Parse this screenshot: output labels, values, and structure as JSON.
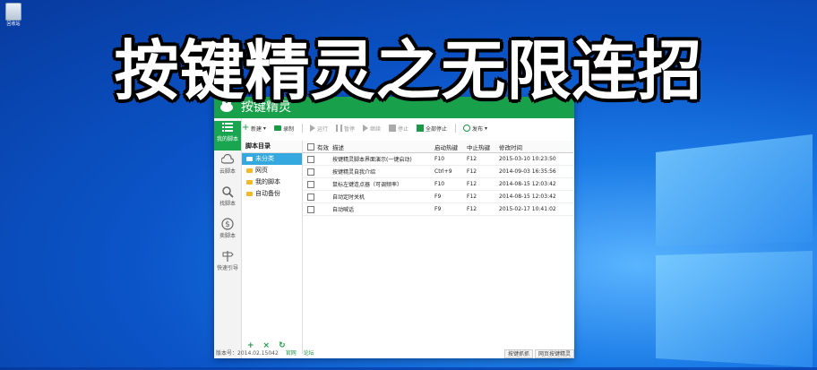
{
  "desktop": {
    "recycle_label": "回收站",
    "headline": "按键精灵之无限连招"
  },
  "app": {
    "title": "按键精灵",
    "sidebar": [
      {
        "label": "我的脚本",
        "icon": "list-icon",
        "active": true
      },
      {
        "label": "云脚本",
        "icon": "cloud-icon",
        "active": false
      },
      {
        "label": "找脚本",
        "icon": "search-icon",
        "active": false
      },
      {
        "label": "卖脚本",
        "icon": "dollar-icon",
        "active": false
      },
      {
        "label": "快速引导",
        "icon": "signpost-icon",
        "active": false
      }
    ],
    "toolbar": {
      "new": "新建",
      "record": "录制",
      "run": "运行",
      "pause": "暂停",
      "resume": "继续",
      "stop": "停止",
      "stop_all": "全部停止",
      "publish": "发布"
    },
    "dir": {
      "header": "脚本目录",
      "items": [
        "未分类",
        "网页",
        "我的脚本",
        "自动备份"
      ],
      "selected": 0,
      "actions": [
        "+",
        "×",
        "↻"
      ]
    },
    "table": {
      "columns": [
        "有效",
        "描述",
        "启动热键",
        "中止热键",
        "修改时间"
      ],
      "rows": [
        {
          "desc": "按键精灵脚本界面演示(一键启动)",
          "hotkey": "F10",
          "stop": "F12",
          "time": "2015-03-10 10:23:50"
        },
        {
          "desc": "按键精灵自我介绍",
          "hotkey": "Ctrl+9",
          "stop": "F12",
          "time": "2014-09-03 16:35:56"
        },
        {
          "desc": "鼠标左键连点器（可调频率）",
          "hotkey": "F10",
          "stop": "F12",
          "time": "2014-08-15 12:03:42"
        },
        {
          "desc": "自动定时关机",
          "hotkey": "F9",
          "stop": "F12",
          "time": "2014-08-15 12:03:42"
        },
        {
          "desc": "自动喊话",
          "hotkey": "F9",
          "stop": "F12",
          "time": "2015-02-17 10:41:02"
        }
      ]
    },
    "status": {
      "version": "版本号：2014.02.15042",
      "link1": "官网",
      "link2": "论坛"
    },
    "bottom_tabs": [
      "按键抓抓",
      "网页按键精灵"
    ]
  },
  "colors": {
    "accent": "#19a04a",
    "selection": "#35a8e0",
    "desktop": "#0b55c9"
  }
}
